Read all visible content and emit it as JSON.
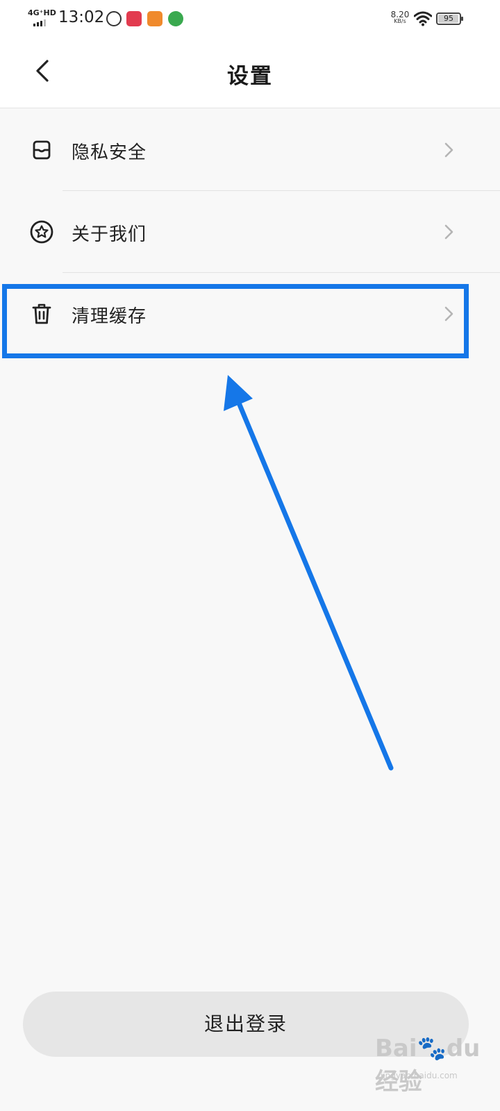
{
  "status_bar": {
    "network": "4G⁺HD",
    "time": "13:02",
    "speed_value": "8.20",
    "speed_unit": "KB/s",
    "battery": "95",
    "battery_level": 0.95
  },
  "header": {
    "title": "设置"
  },
  "menu": {
    "items": [
      {
        "label": "隐私安全",
        "icon": "privacy-icon"
      },
      {
        "label": "关于我们",
        "icon": "star-badge-icon"
      },
      {
        "label": "清理缓存",
        "icon": "trash-icon"
      }
    ]
  },
  "logout": {
    "label": "退出登录"
  },
  "watermark": {
    "logo": "Bai🐾du 经验",
    "url": "jingyan.baidu.com"
  },
  "colors": {
    "annotation": "#1577e8",
    "background": "#f8f8f8",
    "logout_bg": "#e6e6e6"
  }
}
